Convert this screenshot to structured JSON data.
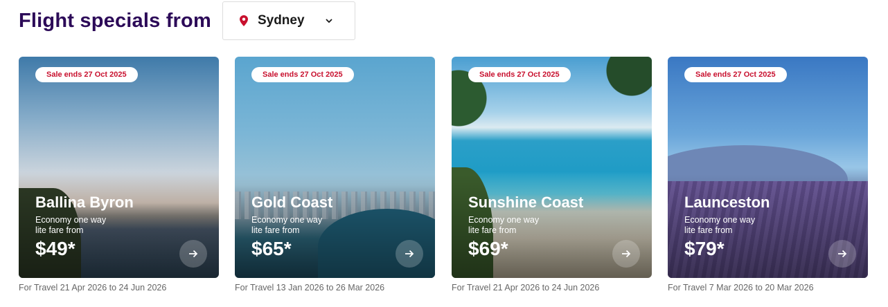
{
  "header": {
    "title": "Flight specials from",
    "city": "Sydney",
    "icons": {
      "location": "location-pin-icon",
      "dropdown": "chevron-down-icon"
    }
  },
  "cards": [
    {
      "sale": "Sale ends 27 Oct 2025",
      "destination": "Ballina Byron",
      "fare_line1": "Economy one way",
      "fare_line2": "lite fare from",
      "price": "$49*",
      "travel": "For Travel 21 Apr 2026 to 24 Jun 2026"
    },
    {
      "sale": "Sale ends 27 Oct 2025",
      "destination": "Gold Coast",
      "fare_line1": "Economy one way",
      "fare_line2": "lite fare from",
      "price": "$65*",
      "travel": "For Travel 13 Jan 2026 to 26 Mar 2026"
    },
    {
      "sale": "Sale ends 27 Oct 2025",
      "destination": "Sunshine Coast",
      "fare_line1": "Economy one way",
      "fare_line2": "lite fare from",
      "price": "$69*",
      "travel": "For Travel 21 Apr 2026 to 24 Jun 2026"
    },
    {
      "sale": "Sale ends 27 Oct 2025",
      "destination": "Launceston",
      "fare_line1": "Economy one way",
      "fare_line2": "lite fare from",
      "price": "$79*",
      "travel": "For Travel 7 Mar 2026 to 20 Mar 2026"
    }
  ],
  "colors": {
    "title": "#2c0a58",
    "sale_badge_text": "#c8102e",
    "location_pin": "#c8102e"
  }
}
